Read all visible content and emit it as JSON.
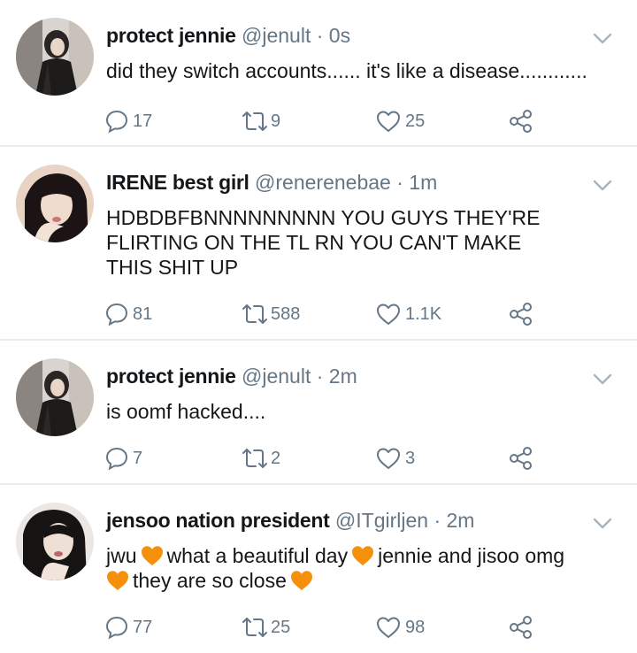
{
  "tweets": [
    {
      "name": "protect jennie",
      "handle": "@jenult",
      "dot": "·",
      "time": "0s",
      "lines": [
        [
          "did they switch accounts...... it's like a disease............"
        ]
      ],
      "replies": "17",
      "retweets": "9",
      "likes": "25"
    },
    {
      "name": "IRENE best girl",
      "handle": "@renerenebae",
      "dot": "·",
      "time": "1m",
      "lines": [
        [
          "HDBDBFBNNNNNNNNN YOU GUYS THEY'RE"
        ],
        [
          "FLIRTING ON THE TL RN YOU CAN'T MAKE"
        ],
        [
          "THIS SHIT UP"
        ]
      ],
      "replies": "81",
      "retweets": "588",
      "likes": "1.1K"
    },
    {
      "name": "protect jennie",
      "handle": "@jenult",
      "dot": "·",
      "time": "2m",
      "lines": [
        [
          "is oomf hacked...."
        ]
      ],
      "replies": "7",
      "retweets": "2",
      "likes": "3"
    },
    {
      "name": "jensoo nation president",
      "handle": "@ITgirljen",
      "dot": "·",
      "time": "2m",
      "lines": [
        [
          "jwu",
          "what a beautiful day",
          "jennie and jisoo omg"
        ],
        [
          "they are so close"
        ]
      ],
      "replies": "77",
      "retweets": "25",
      "likes": "98"
    }
  ],
  "colors": {
    "text": "#14171a",
    "muted": "#657786",
    "divider": "#e6ecf0",
    "orange_heart": "#f4900c"
  },
  "icons": {
    "reply": "reply-icon",
    "retweet": "retweet-icon",
    "like": "heart-outline-icon",
    "share": "share-icon",
    "menu": "chevron-down-icon",
    "emoji": "orange-heart-emoji"
  }
}
